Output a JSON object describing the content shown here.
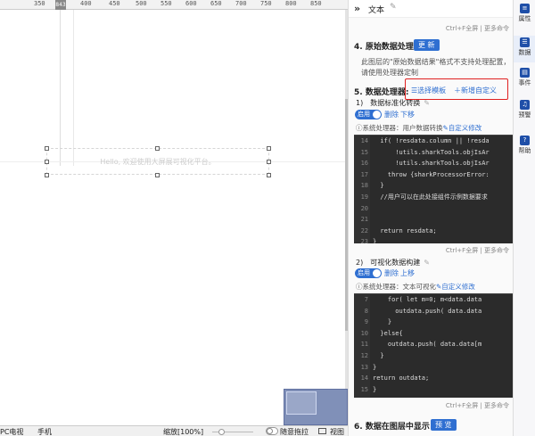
{
  "ruler": {
    "ticks": [
      "350",
      "400",
      "450",
      "500",
      "550",
      "600",
      "650",
      "700",
      "750",
      "800",
      "850"
    ],
    "position_marker": "843"
  },
  "canvas": {
    "widget_placeholder": "Hello, 欢迎使用大屏展可视化平台。"
  },
  "bottombar": {
    "tab_pc": "PC电视",
    "tab_mobile": "手机",
    "zoom_label": "缩放[100%]",
    "drag_label": "随意拖拉",
    "view_label": "视图"
  },
  "panel": {
    "header_title": "文本",
    "ctrlf_hint": "Ctrl+F全屏 | 更多命令",
    "section4": {
      "title": "4. 原始数据处理",
      "update_button": "更 新"
    },
    "section4_desc": "此图层的\"原始数据结果\"格式不支持处理配置，请使用处理器定制",
    "section5": {
      "title": "5. 数据处理器:",
      "select_template": "☰选择模板",
      "add_custom": "＋新增自定义"
    },
    "processor1": {
      "title": "1)　数据标准化转换",
      "enable": "启用",
      "delete": "删除",
      "move": "下移",
      "sys_prefix": "ⓘ系统处理器：用户数据转换",
      "custom_edit": "✎自定义修改",
      "code": [
        {
          "n": "14",
          "t": "  if( !resdata.column || !resda"
        },
        {
          "n": "15",
          "t": "      !utils.sharkTools.objIsAr"
        },
        {
          "n": "16",
          "t": "      !utils.sharkTools.objIsAr"
        },
        {
          "n": "17",
          "t": "    throw {sharkProcessorError:"
        },
        {
          "n": "18",
          "t": "  }"
        },
        {
          "n": "19",
          "t": "  //用户可以在此处接组件示例数据要求"
        },
        {
          "n": "20",
          "t": ""
        },
        {
          "n": "21",
          "t": ""
        },
        {
          "n": "22",
          "t": "  return resdata;"
        },
        {
          "n": "23",
          "t": "}"
        }
      ]
    },
    "processor2": {
      "title": "2)　可视化数据构建",
      "enable": "启用",
      "delete": "删除",
      "move": "上移",
      "sys_prefix": "ⓘ系统处理器：文本可视化",
      "custom_edit": "✎自定义修改",
      "code": [
        {
          "n": "7",
          "t": "    for( let m=0; m<data.data"
        },
        {
          "n": "8",
          "t": "      outdata.push( data.data"
        },
        {
          "n": "9",
          "t": "    }"
        },
        {
          "n": "10",
          "t": "  }else{"
        },
        {
          "n": "11",
          "t": "    outdata.push( data.data[m"
        },
        {
          "n": "12",
          "t": "  }"
        },
        {
          "n": "13",
          "t": "}"
        },
        {
          "n": "14",
          "t": "return outdata;"
        },
        {
          "n": "15",
          "t": "}"
        }
      ]
    },
    "section6": {
      "title": "6. 数据在图层中显示",
      "preview_button": "预 览"
    }
  },
  "rightbar": {
    "items": [
      {
        "label": "属性",
        "icon": "properties-icon"
      },
      {
        "label": "数据",
        "icon": "database-icon"
      },
      {
        "label": "事件",
        "icon": "event-icon"
      },
      {
        "label": "预警",
        "icon": "alarm-icon"
      },
      {
        "label": "帮助",
        "icon": "help-icon"
      }
    ]
  },
  "colors": {
    "accent": "#2f6fd1",
    "highlight_box": "#e02020",
    "code_bg": "#2b2b2b",
    "sidebar_icon": "#1f4fa8"
  }
}
